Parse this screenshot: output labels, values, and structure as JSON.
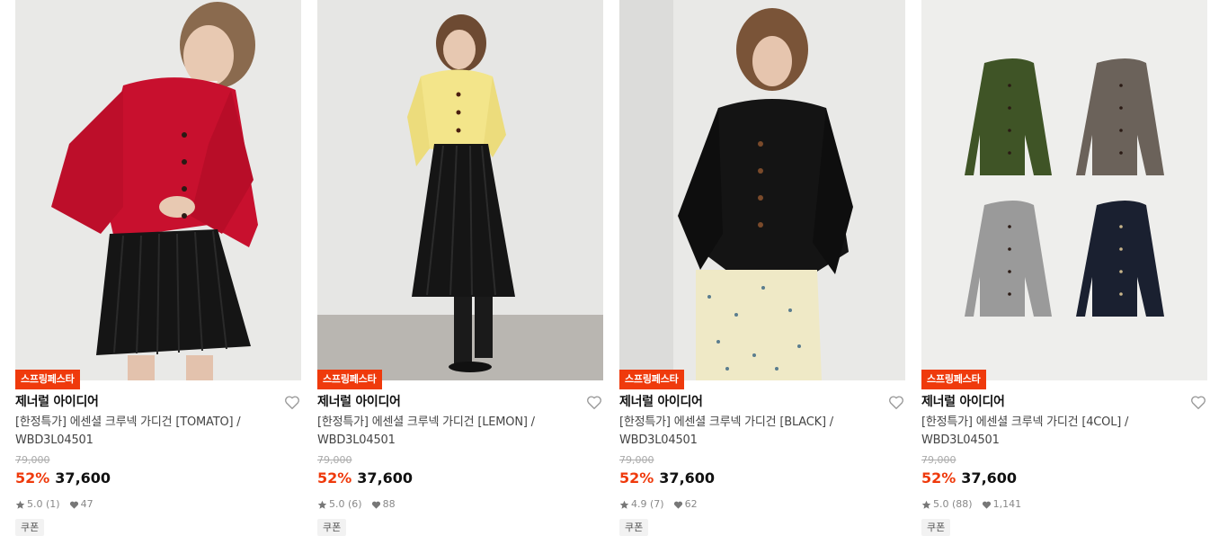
{
  "products": [
    {
      "badge": "스프링페스타",
      "brand": "제너럴 아이디어",
      "name_line1": "[한정특가] 에센셜 크루넥 가디건 [TOMATO] /",
      "name_line2": "WBD3L04501",
      "original_price": "79,000",
      "discount": "52%",
      "price": "37,600",
      "rating": "5.0 (1)",
      "likes": "47",
      "coupon": "쿠폰",
      "image": "model-red-cardigan",
      "colors": {
        "top": "#c8102e",
        "bottom": "#151515",
        "bg": "#ececea"
      }
    },
    {
      "badge": "스프링페스타",
      "brand": "제너럴 아이디어",
      "name_line1": "[한정특가] 에센셜 크루넥 가디건 [LEMON] /",
      "name_line2": "WBD3L04501",
      "original_price": "79,000",
      "discount": "52%",
      "price": "37,600",
      "rating": "5.0 (6)",
      "likes": "88",
      "coupon": "쿠폰",
      "image": "model-yellow-cardigan",
      "colors": {
        "top": "#f3e58a",
        "bottom": "#151515",
        "bg": "#e6e6e4"
      }
    },
    {
      "badge": "스프링페스타",
      "brand": "제너럴 아이디어",
      "name_line1": "[한정특가] 에센셜 크루넥 가디건 [BLACK] /",
      "name_line2": "WBD3L04501",
      "original_price": "79,000",
      "discount": "52%",
      "price": "37,600",
      "rating": "4.9 (7)",
      "likes": "62",
      "coupon": "쿠폰",
      "image": "model-black-cardigan",
      "colors": {
        "top": "#141414",
        "bottom": "#efe9c6",
        "bg": "#e9e9e7"
      }
    },
    {
      "badge": "스프링페스타",
      "brand": "제너럴 아이디어",
      "name_line1": "[한정특가] 에센셜 크루넥 가디건 [4COL] /",
      "name_line2": "WBD3L04501",
      "original_price": "79,000",
      "discount": "52%",
      "price": "37,600",
      "rating": "5.0 (88)",
      "likes": "1,141",
      "coupon": "쿠폰",
      "image": "four-color-flatlay",
      "colors": {
        "green": "#3f5426",
        "brown": "#6b625a",
        "grey": "#9a9a9a",
        "navy": "#1a2030",
        "bg": "#eeeeec"
      }
    }
  ],
  "icons": {
    "wish": "heart-outline-icon",
    "star": "star-icon",
    "like": "heart-filled-icon"
  },
  "accent_color": "#ef3a0c"
}
